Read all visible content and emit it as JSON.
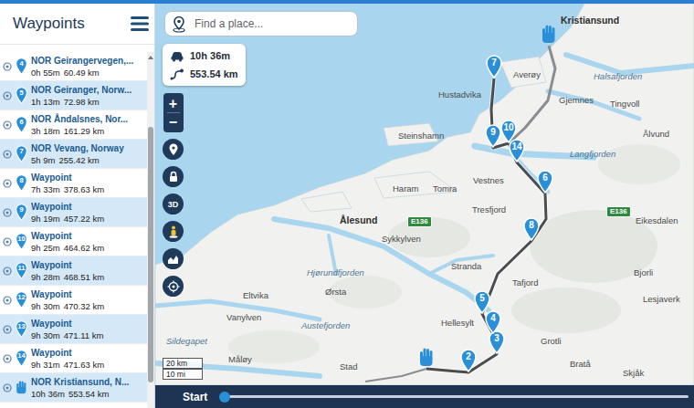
{
  "sidebar": {
    "title": "Waypoints"
  },
  "waypoints": [
    {
      "kind": "stop",
      "number": "4",
      "title": "NOR Geirangervegen,...",
      "time": "0h 55m",
      "distance": "60.49 km"
    },
    {
      "kind": "stop",
      "number": "5",
      "title": "NOR Geiranger, Norw...",
      "time": "1h 13m",
      "distance": "72.98 km"
    },
    {
      "kind": "stop",
      "number": "6",
      "title": "NOR Åndalsnes, Nor...",
      "time": "3h 18m",
      "distance": "161.29 km"
    },
    {
      "kind": "stop",
      "number": "7",
      "title": "NOR Vevang, Norway",
      "time": "5h 9m",
      "distance": "255.42 km"
    },
    {
      "kind": "stop",
      "number": "8",
      "title": "Waypoint",
      "time": "7h 33m",
      "distance": "378.63 km"
    },
    {
      "kind": "stop",
      "number": "9",
      "title": "Waypoint",
      "time": "9h 19m",
      "distance": "457.22 km"
    },
    {
      "kind": "stop",
      "number": "10",
      "title": "Waypoint",
      "time": "9h 25m",
      "distance": "464.62 km"
    },
    {
      "kind": "stop",
      "number": "11",
      "title": "Waypoint",
      "time": "9h 28m",
      "distance": "468.51 km"
    },
    {
      "kind": "stop",
      "number": "12",
      "title": "Waypoint",
      "time": "9h 30m",
      "distance": "470.32 km"
    },
    {
      "kind": "stop",
      "number": "13",
      "title": "Waypoint",
      "time": "9h 30m",
      "distance": "471.11 km"
    },
    {
      "kind": "stop",
      "number": "14",
      "title": "Waypoint",
      "time": "9h 31m",
      "distance": "471.63 km"
    },
    {
      "kind": "end",
      "title": "NOR Kristiansund, N...",
      "time": "10h 36m",
      "distance": "553.54 km"
    }
  ],
  "search": {
    "placeholder": "Find a place..."
  },
  "summary": {
    "duration": "10h 36m",
    "distance": "553.54 km"
  },
  "zoom": {
    "in": "+",
    "out": "−"
  },
  "tools": {
    "three_d": "3D"
  },
  "scale": [
    "20 km",
    "10 mi"
  ],
  "map": {
    "labels": [
      {
        "text": "Kristiansund",
        "kind": "city"
      },
      {
        "text": "Averøy",
        "kind": "town"
      },
      {
        "text": "Halsafjorden",
        "kind": "water"
      },
      {
        "text": "Gjemnes",
        "kind": "town"
      },
      {
        "text": "Tingvoll",
        "kind": "town"
      },
      {
        "text": "Hustadvika",
        "kind": "town"
      },
      {
        "text": "Steinshamn",
        "kind": "town"
      },
      {
        "text": "Langfjorden",
        "kind": "water"
      },
      {
        "text": "Ålvund",
        "kind": "town"
      },
      {
        "text": "Haram",
        "kind": "town"
      },
      {
        "text": "Tomra",
        "kind": "town"
      },
      {
        "text": "Vestnes",
        "kind": "town"
      },
      {
        "text": "Tresfjord",
        "kind": "town"
      },
      {
        "text": "Ålesund",
        "kind": "city"
      },
      {
        "text": "E136",
        "kind": "road"
      },
      {
        "text": "E136",
        "kind": "road"
      },
      {
        "text": "Sykkylven",
        "kind": "town"
      },
      {
        "text": "Eikesdalen",
        "kind": "town"
      },
      {
        "text": "Stranda",
        "kind": "town"
      },
      {
        "text": "Hjørundfjorden",
        "kind": "water"
      },
      {
        "text": "Tafjord",
        "kind": "town"
      },
      {
        "text": "Bjorli",
        "kind": "town"
      },
      {
        "text": "Eltvika",
        "kind": "town"
      },
      {
        "text": "Ørsta",
        "kind": "town"
      },
      {
        "text": "Lesjaverk",
        "kind": "town"
      },
      {
        "text": "Vanylven",
        "kind": "town"
      },
      {
        "text": "Hellesylt",
        "kind": "town"
      },
      {
        "text": "Austefjorden",
        "kind": "water"
      },
      {
        "text": "Grotli",
        "kind": "town"
      },
      {
        "text": "Sildegapet",
        "kind": "water"
      },
      {
        "text": "Stad",
        "kind": "town"
      },
      {
        "text": "Måløy",
        "kind": "town"
      },
      {
        "text": "Bratå",
        "kind": "town"
      },
      {
        "text": "Skjåk",
        "kind": "town"
      }
    ],
    "pins": [
      {
        "kind": "start"
      },
      {
        "kind": "numbered",
        "label": "2"
      },
      {
        "kind": "numbered",
        "label": "3"
      },
      {
        "kind": "numbered",
        "label": "4"
      },
      {
        "kind": "numbered",
        "label": "5"
      },
      {
        "kind": "numbered",
        "label": "6"
      },
      {
        "kind": "numbered",
        "label": "7"
      },
      {
        "kind": "numbered",
        "label": "8"
      },
      {
        "kind": "numbered",
        "label": "9"
      },
      {
        "kind": "numbered",
        "label": "10"
      },
      {
        "kind": "numbered",
        "label": "14"
      },
      {
        "kind": "end"
      }
    ]
  },
  "timeline": {
    "label": "Start",
    "level": 0
  }
}
